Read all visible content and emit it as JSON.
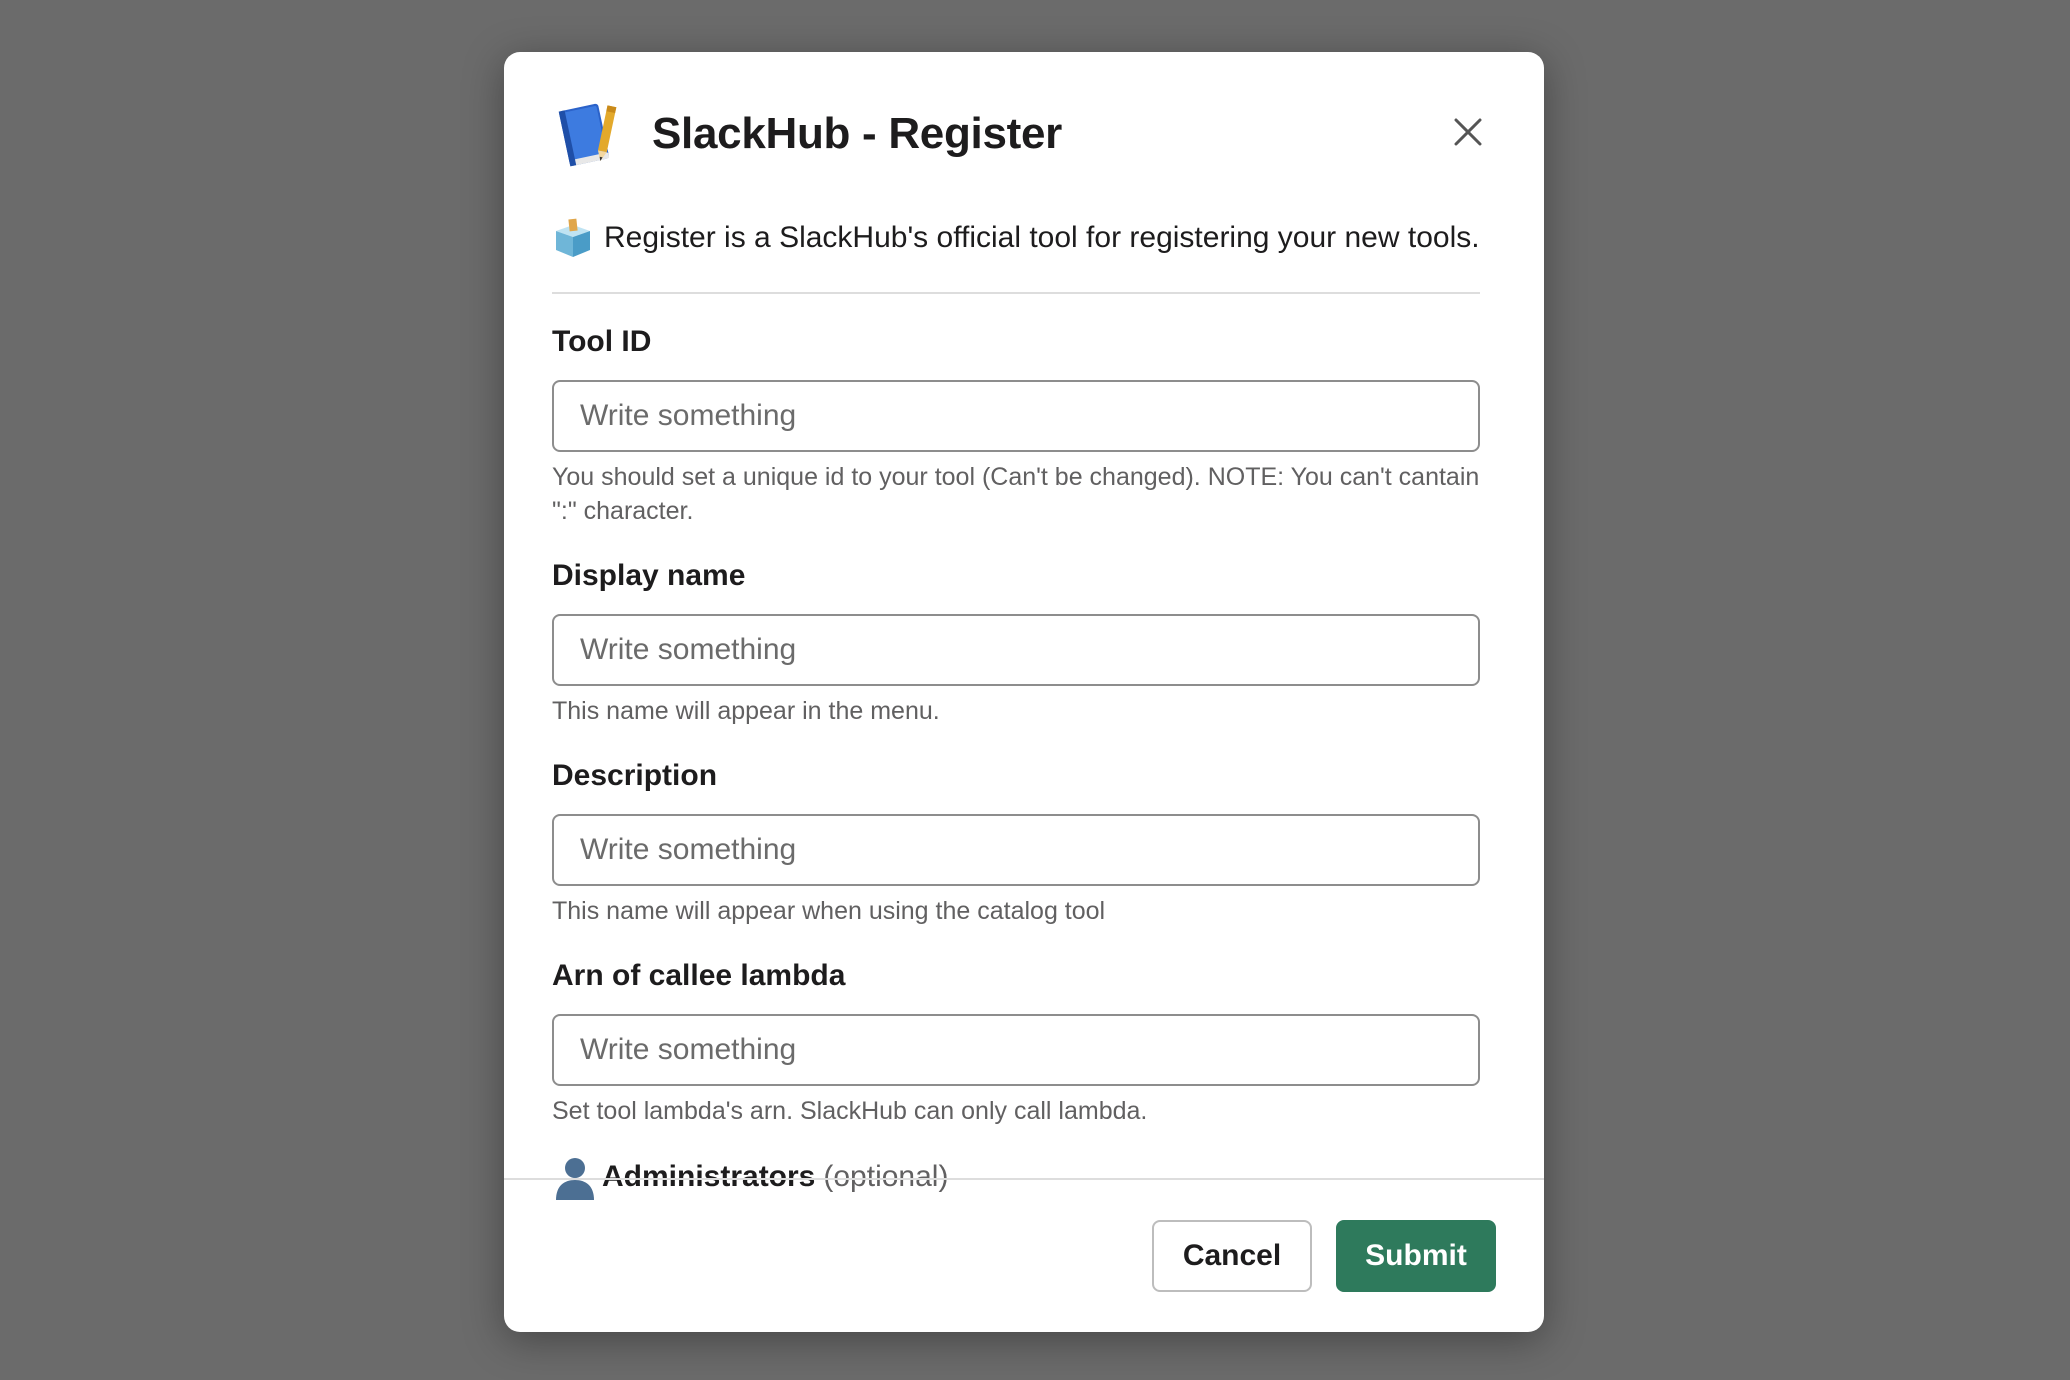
{
  "modal": {
    "title": "SlackHub - Register",
    "app_icon": "blue-book-pencil-icon",
    "close_icon": "close-icon",
    "intro_icon": "ballot-box-icon",
    "intro_text": "Register is a SlackHub's official tool for registering your new tools."
  },
  "fields": {
    "tool_id": {
      "label": "Tool ID",
      "placeholder": "Write something",
      "value": "",
      "hint": "You should set a unique id to your tool (Can't be changed). NOTE: You can't cantain \":\" character."
    },
    "display_name": {
      "label": "Display name",
      "placeholder": "Write something",
      "value": "",
      "hint": "This name will appear in the menu."
    },
    "description": {
      "label": "Description",
      "placeholder": "Write something",
      "value": "",
      "hint": "This name will appear when using the catalog tool"
    },
    "lambda_arn": {
      "label": "Arn of callee lambda",
      "placeholder": "Write something",
      "value": "",
      "hint": "Set tool lambda's arn. SlackHub can only call lambda."
    }
  },
  "administrators": {
    "icon": "person-silhouette-icon",
    "label": "Administrators",
    "optional": "(optional)"
  },
  "footer": {
    "cancel_label": "Cancel",
    "submit_label": "Submit"
  },
  "colors": {
    "backdrop": "#6b6b6b",
    "submit": "#2e7a5c",
    "text": "#1d1c1d",
    "hint": "#616061"
  }
}
